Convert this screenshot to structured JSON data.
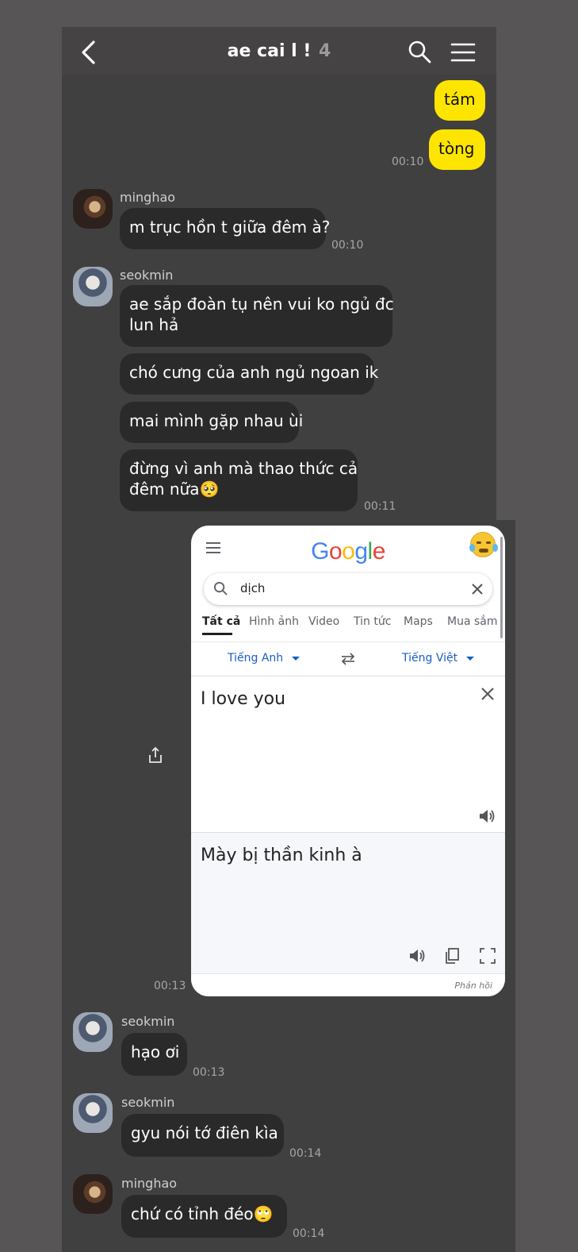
{
  "header": {
    "title": "ae cai l !",
    "member_count": "4"
  },
  "messages_mine": {
    "m1": "tám",
    "m2": "tòng",
    "time": "00:10"
  },
  "group1": {
    "sender": "minghao",
    "text": "m trục hồn t giữa đêm à?",
    "time": "00:10"
  },
  "group2": {
    "sender": "seokmin",
    "line1a": "ae sắp đoàn tụ nên vui ko ngủ đc",
    "line1b": "lun hả",
    "line2": "chó cưng của anh ngủ ngoan ik",
    "line3": "mai mình gặp nhau ùi",
    "line4a": "đừng vì anh mà thao thức cả",
    "line4b": "đêm nữa🥺",
    "time": "00:11"
  },
  "screenshot_msg": {
    "time": "00:13",
    "google": {
      "logo": "Google",
      "query": "dịch",
      "tabs": [
        "Tất cả",
        "Hình ảnh",
        "Video",
        "Tin tức",
        "Maps",
        "Mua sắm"
      ],
      "source_lang": "Tiếng Anh",
      "target_lang": "Tiếng Việt",
      "source_text": "I love you",
      "target_text": "Mày bị thần kinh à",
      "feedback": "Phản hồi"
    }
  },
  "group3": {
    "sender": "seokmin",
    "text": "hạo ơi",
    "time": "00:13"
  },
  "group4": {
    "sender": "seokmin",
    "text": "gyu nói tớ điên kìa",
    "time": "00:14"
  },
  "group5": {
    "sender": "minghao",
    "text": "chứ có tỉnh đéo🙄",
    "time": "00:14"
  },
  "colors": {
    "my_bubble": "#fee500",
    "their_bubble": "#2b2a2b",
    "chat_bg": "#414041",
    "outer_bg": "#575556"
  }
}
